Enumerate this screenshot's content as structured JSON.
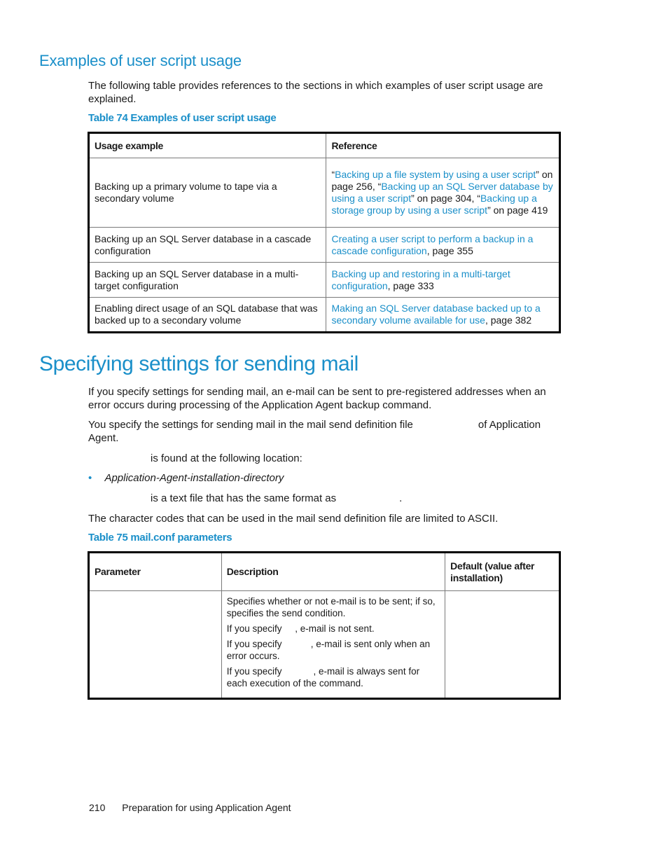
{
  "section1": {
    "heading": "Examples of user script usage",
    "intro": "The following table provides references to the sections in which examples of user script usage are explained.",
    "table_caption": "Table 74 Examples of user script usage",
    "table": {
      "headers": [
        "Usage example",
        "Reference"
      ],
      "rows": [
        {
          "usage": "Backing up a primary volume to tape via a secondary volume",
          "ref": [
            {
              "t": "“",
              "link": false
            },
            {
              "t": "Backing up a file system by using a user script",
              "link": true
            },
            {
              "t": "” on page 256, “",
              "link": false
            },
            {
              "t": "Backing up an SQL Server database by using a user script",
              "link": true
            },
            {
              "t": "” on page 304, “",
              "link": false
            },
            {
              "t": "Backing up a storage group by using a user script",
              "link": true
            },
            {
              "t": "” on page 419",
              "link": false
            }
          ]
        },
        {
          "usage": "Backing up an SQL Server database in a cascade configuration",
          "ref": [
            {
              "t": "Creating a user script to perform a backup in a cascade configuration",
              "link": true
            },
            {
              "t": ", page 355",
              "link": false
            }
          ]
        },
        {
          "usage": "Backing up an SQL Server database in a multi-target configuration",
          "ref": [
            {
              "t": "Backing up and restoring in a multi-target configuration",
              "link": true
            },
            {
              "t": ", page 333",
              "link": false
            }
          ]
        },
        {
          "usage": "Enabling direct usage of an SQL database that was backed up to a secondary volume",
          "ref": [
            {
              "t": "Making an SQL Server database backed up to a secondary volume available for use",
              "link": true
            },
            {
              "t": ", page 382",
              "link": false
            }
          ]
        }
      ]
    }
  },
  "section2": {
    "heading": "Specifying settings for sending mail",
    "para1": "If you specify settings for sending mail, an e-mail can be sent to pre-registered addresses when an error occurs during processing of the Application Agent backup command.",
    "para2a": "You specify the settings for sending mail in the mail send definition file",
    "para2b": "of Application Agent.",
    "para3": "is found at the following location:",
    "bullet": "Application-Agent-installation-directory",
    "para4a": "is a text file that has the same format as",
    "para4b": ".",
    "para5": "The character codes that can be used in the mail send definition file are limited to ASCII.",
    "table_caption": "Table 75 mail.conf parameters",
    "table": {
      "headers": [
        "Parameter",
        "Description",
        "Default (value after installation)"
      ],
      "rows": [
        {
          "parameter": "",
          "description": [
            "Specifies whether or not e-mail is to be sent; if so, specifies the send condition.",
            "If you specify     , e-mail is not sent.",
            "If you specify           , e-mail is sent only when an error occurs.",
            "If you specify            , e-mail is always sent for each execution of the command."
          ],
          "default": ""
        }
      ]
    }
  },
  "footer": {
    "page_number": "210",
    "title": "Preparation for using Application Agent"
  }
}
